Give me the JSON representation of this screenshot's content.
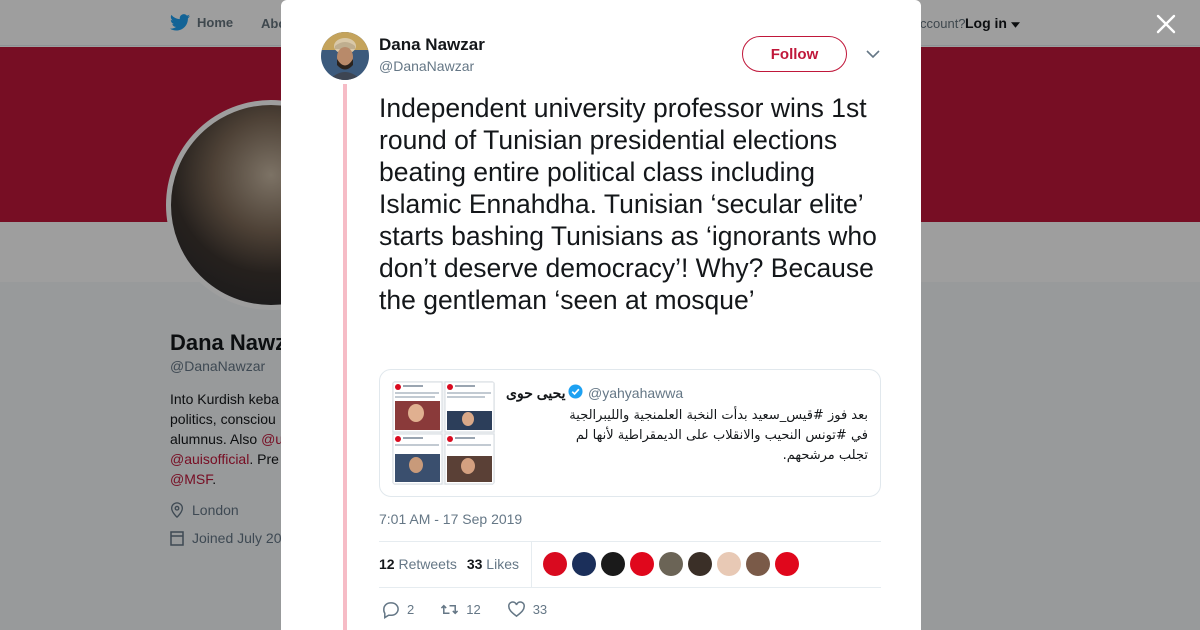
{
  "nav": {
    "home": "Home",
    "about": "Abo",
    "account": "ccount?",
    "login": "Log in"
  },
  "profile": {
    "name": "Dana Nawz",
    "handle": "@DanaNawzar",
    "bio_line1": "Into Kurdish keba",
    "bio_line2": "politics, consciou",
    "bio_line3_text": "alumnus. Also ",
    "bio_line3_link": "@u",
    "bio_line4_link": "@auisofficial",
    "bio_line4_text": ". Pre",
    "bio_line5_link": "@MSF",
    "bio_line5_text": ".",
    "location": "London",
    "joined": "Joined July 20"
  },
  "tweet": {
    "author_name": "Dana Nawzar",
    "author_handle": "@DanaNawzar",
    "follow_label": "Follow",
    "text": "Independent university professor wins 1st round of Tunisian presidential elections beating entire political class including Islamic Ennahdha. Tunisian ‘secular elite’ starts bashing Tunisians as ‘ignorants who don’t deserve democracy’! Why? Because the gentleman ‘seen at mosque’",
    "timestamp": "7:01 AM - 17 Sep 2019",
    "retweets_count": "12",
    "retweets_label": "Retweets",
    "likes_count": "33",
    "likes_label": "Likes",
    "replies": "2",
    "retweets_action": "12",
    "likes_action": "33"
  },
  "quote": {
    "name": "يحيى حوى",
    "handle": "@yahyahawwa",
    "text": "بعد فوز #قيس_سعيد بدأت النخبة العلمنجية والليبرالجية في #تونس النحيب والانقلاب على الديمقراطية لأنها لم تجلب مرشحهم."
  },
  "colors": {
    "accent": "#c0173a",
    "verified": "#1da1f2"
  },
  "likers": [
    "#d90a1f",
    "#1b2f5a",
    "#1a1a1a",
    "#e0071c",
    "#6b6456",
    "#3a2f27",
    "#e8c9b5",
    "#7a5a48",
    "#e0071c"
  ]
}
